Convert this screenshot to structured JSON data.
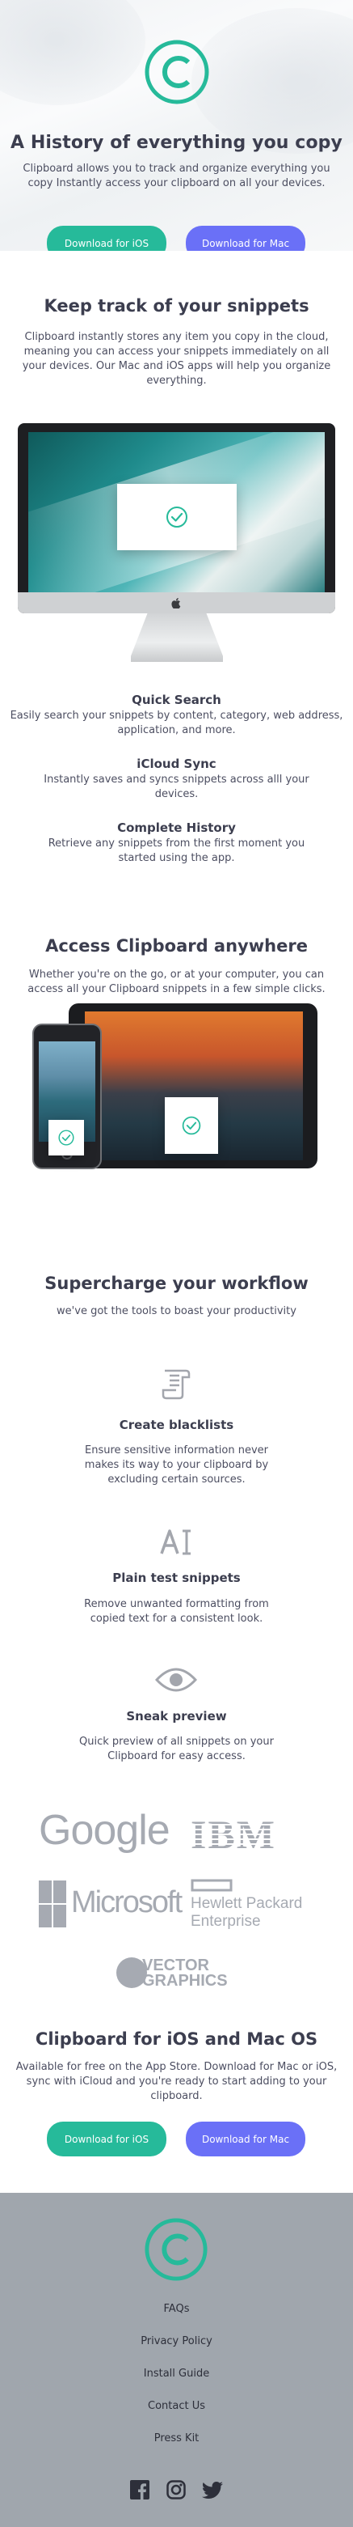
{
  "hero": {
    "title": "A History of everything you copy",
    "description": "Clipboard allows you to track and organize everything you copy Instantly access your clipboard on all your devices.",
    "ios_button": "Download for iOS",
    "mac_button": "Download for Mac"
  },
  "snippets": {
    "title": "Keep track of your snippets",
    "description": "Clipboard instantly stores any item you copy in the cloud, meaning you can access your snippets immediately on all your devices. Our Mac and iOS apps will help you organize everything.",
    "features": [
      {
        "title": "Quick Search",
        "text": "Easily search your snippets by content, category, web address, application, and more."
      },
      {
        "title": "iCloud Sync",
        "text": "Instantly saves and syncs snippets across alll your devices."
      },
      {
        "title": "Complete History",
        "text": "Retrieve any snippets from the first moment you started using the app."
      }
    ]
  },
  "access": {
    "title": "Access Clipboard anywhere",
    "description": "Whether you're on the go, or at your computer, you can access all your Clipboard snippets in a few simple clicks."
  },
  "workflow": {
    "title": "Supercharge your workflow",
    "subtitle": "we've got the tools to boast your productivity",
    "items": [
      {
        "icon": "blacklist-icon",
        "title": "Create blacklists",
        "text": "Ensure sensitive information never makes its way to your clipboard by excluding certain sources."
      },
      {
        "icon": "text-icon",
        "title": "Plain test snippets",
        "text": "Remove unwanted formatting from copied text for a consistent look."
      },
      {
        "icon": "eye-icon",
        "title": "Sneak preview",
        "text": "Quick preview of all snippets on your Clipboard for easy access."
      }
    ]
  },
  "brands": {
    "google": "Google",
    "ibm": "IBM",
    "microsoft": "Microsoft",
    "hp_line1": "Hewlett Packard",
    "hp_line2": "Enterprise",
    "vector_line1": "VECTOR",
    "vector_line2": "GRAPHICS"
  },
  "cta": {
    "title": "Clipboard for iOS and Mac OS",
    "description": "Available for free on the App Store. Download for Mac or iOS, sync with iCloud and you're ready to start adding to your clipboard.",
    "ios_button": "Download for iOS",
    "mac_button": "Download for Mac"
  },
  "footer": {
    "links": [
      "FAQs",
      "Privacy Policy",
      "Install Guide",
      "Contact Us",
      "Press Kit"
    ],
    "social": [
      "facebook-icon",
      "instagram-icon",
      "twitter-icon"
    ]
  },
  "colors": {
    "accent_green": "#26ba9a",
    "accent_blue": "#6a70f7",
    "footer_bg": "#a0a6ad",
    "heading": "#3c3e4f"
  }
}
